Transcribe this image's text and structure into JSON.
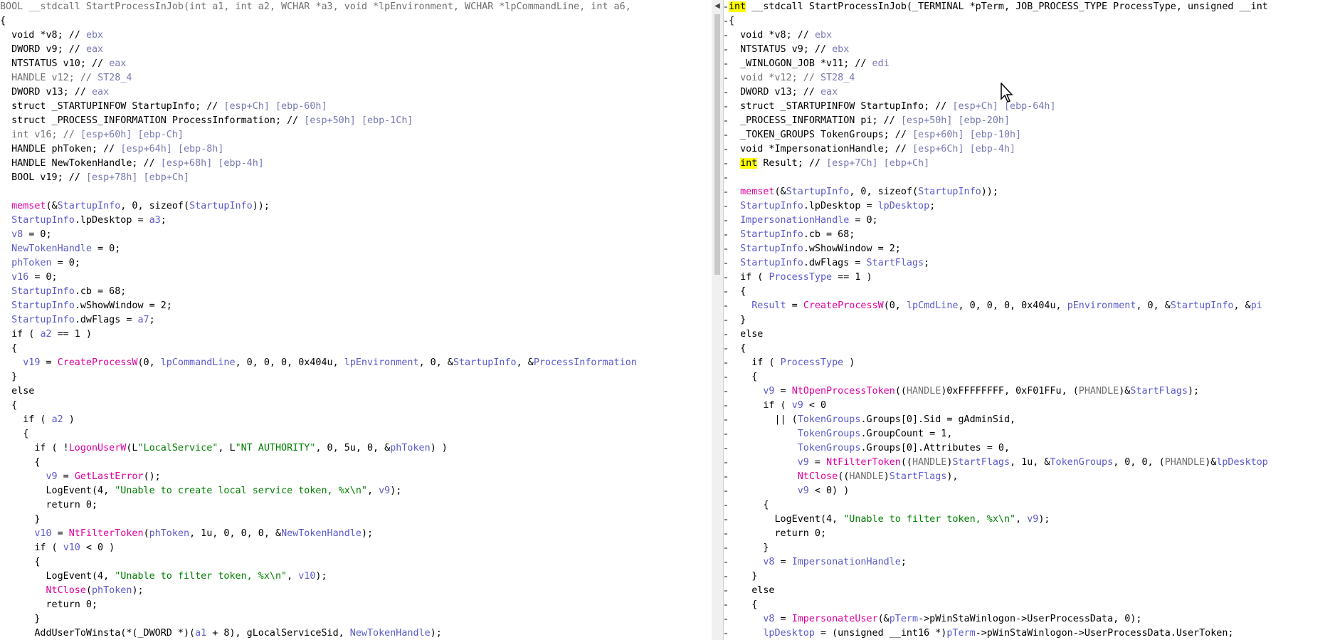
{
  "left_pane": {
    "lines": [
      [
        [
          "g",
          "BOOL __stdcall StartProcessInJob(int a1, int a2, WCHAR *a3, void *lpEnvironment, WCHAR *lpCommandLine, int a6, "
        ]
      ],
      [
        [
          "k",
          "{"
        ]
      ],
      [
        [
          "k",
          "  void *v8; // "
        ],
        [
          "c",
          "ebx"
        ]
      ],
      [
        [
          "k",
          "  DWORD v9; // "
        ],
        [
          "c",
          "eax"
        ]
      ],
      [
        [
          "k",
          "  NTSTATUS v10; // "
        ],
        [
          "c",
          "eax"
        ]
      ],
      [
        [
          "g",
          "  HANDLE v12; // "
        ],
        [
          "c",
          "ST28_4"
        ]
      ],
      [
        [
          "k",
          "  DWORD v13; // "
        ],
        [
          "c",
          "eax"
        ]
      ],
      [
        [
          "k",
          "  struct _STARTUPINFOW StartupInfo; // "
        ],
        [
          "c",
          "[esp+Ch] [ebp-60h]"
        ]
      ],
      [
        [
          "k",
          "  struct _PROCESS_INFORMATION ProcessInformation; // "
        ],
        [
          "c",
          "[esp+50h] [ebp-1Ch]"
        ]
      ],
      [
        [
          "g",
          "  int v16; // "
        ],
        [
          "c",
          "[esp+60h] [ebp-Ch]"
        ]
      ],
      [
        [
          "k",
          "  HANDLE phToken; // "
        ],
        [
          "c",
          "[esp+64h] [ebp-8h]"
        ]
      ],
      [
        [
          "k",
          "  HANDLE NewTokenHandle; // "
        ],
        [
          "c",
          "[esp+68h] [ebp-4h]"
        ]
      ],
      [
        [
          "k",
          "  BOOL v19; // "
        ],
        [
          "c",
          "[esp+78h] [ebp+Ch]"
        ]
      ],
      [
        [
          "k",
          ""
        ]
      ],
      [
        [
          "f",
          "  memset"
        ],
        [
          "k",
          "(&"
        ],
        [
          "v",
          "StartupInfo"
        ],
        [
          "k",
          ", 0, sizeof("
        ],
        [
          "v",
          "StartupInfo"
        ],
        [
          "k",
          "));"
        ]
      ],
      [
        [
          "v",
          "  StartupInfo"
        ],
        [
          "k",
          ".lpDesktop = "
        ],
        [
          "v",
          "a3"
        ],
        [
          "k",
          ";"
        ]
      ],
      [
        [
          "v",
          "  v8"
        ],
        [
          "k",
          " = 0;"
        ]
      ],
      [
        [
          "v",
          "  NewTokenHandle"
        ],
        [
          "k",
          " = 0;"
        ]
      ],
      [
        [
          "v",
          "  phToken"
        ],
        [
          "k",
          " = 0;"
        ]
      ],
      [
        [
          "v",
          "  v16"
        ],
        [
          "k",
          " = 0;"
        ]
      ],
      [
        [
          "v",
          "  StartupInfo"
        ],
        [
          "k",
          ".cb = 68;"
        ]
      ],
      [
        [
          "v",
          "  StartupInfo"
        ],
        [
          "k",
          ".wShowWindow = 2;"
        ]
      ],
      [
        [
          "v",
          "  StartupInfo"
        ],
        [
          "k",
          ".dwFlags = "
        ],
        [
          "v",
          "a7"
        ],
        [
          "k",
          ";"
        ]
      ],
      [
        [
          "k",
          "  if ( "
        ],
        [
          "v",
          "a2"
        ],
        [
          "k",
          " == 1 )"
        ]
      ],
      [
        [
          "k",
          "  {"
        ]
      ],
      [
        [
          "v",
          "    v19"
        ],
        [
          "k",
          " = "
        ],
        [
          "f",
          "CreateProcessW"
        ],
        [
          "k",
          "(0, "
        ],
        [
          "v",
          "lpCommandLine"
        ],
        [
          "k",
          ", 0, 0, 0, 0x404u, "
        ],
        [
          "v",
          "lpEnvironment"
        ],
        [
          "k",
          ", 0, &"
        ],
        [
          "v",
          "StartupInfo"
        ],
        [
          "k",
          ", &"
        ],
        [
          "v",
          "ProcessInformation"
        ]
      ],
      [
        [
          "k",
          "  }"
        ]
      ],
      [
        [
          "k",
          "  else"
        ]
      ],
      [
        [
          "k",
          "  {"
        ]
      ],
      [
        [
          "k",
          "    if ( "
        ],
        [
          "v",
          "a2"
        ],
        [
          "k",
          " )"
        ]
      ],
      [
        [
          "k",
          "    {"
        ]
      ],
      [
        [
          "k",
          "      if ( !"
        ],
        [
          "f",
          "LogonUserW"
        ],
        [
          "k",
          "(L"
        ],
        [
          "s",
          "\"LocalService\""
        ],
        [
          "k",
          ", L"
        ],
        [
          "s",
          "\"NT AUTHORITY\""
        ],
        [
          "k",
          ", 0, 5u, 0, &"
        ],
        [
          "v",
          "phToken"
        ],
        [
          "k",
          ") )"
        ]
      ],
      [
        [
          "k",
          "      {"
        ]
      ],
      [
        [
          "v",
          "        v9"
        ],
        [
          "k",
          " = "
        ],
        [
          "f",
          "GetLastError"
        ],
        [
          "k",
          "();"
        ]
      ],
      [
        [
          "k",
          "        LogEvent(4, "
        ],
        [
          "s",
          "\"Unable to create local service token, %x\\n\""
        ],
        [
          "k",
          ", "
        ],
        [
          "v",
          "v9"
        ],
        [
          "k",
          ");"
        ]
      ],
      [
        [
          "k",
          "        return 0;"
        ]
      ],
      [
        [
          "k",
          "      }"
        ]
      ],
      [
        [
          "v",
          "      v10"
        ],
        [
          "k",
          " = "
        ],
        [
          "f",
          "NtFilterToken"
        ],
        [
          "k",
          "("
        ],
        [
          "v",
          "phToken"
        ],
        [
          "k",
          ", 1u, 0, 0, 0, &"
        ],
        [
          "v",
          "NewTokenHandle"
        ],
        [
          "k",
          ");"
        ]
      ],
      [
        [
          "k",
          "      if ( "
        ],
        [
          "v",
          "v10"
        ],
        [
          "k",
          " < 0 )"
        ]
      ],
      [
        [
          "k",
          "      {"
        ]
      ],
      [
        [
          "k",
          "        LogEvent(4, "
        ],
        [
          "s",
          "\"Unable to filter token, %x\\n\""
        ],
        [
          "k",
          ", "
        ],
        [
          "v",
          "v10"
        ],
        [
          "k",
          ");"
        ]
      ],
      [
        [
          "f",
          "        NtClose"
        ],
        [
          "k",
          "("
        ],
        [
          "v",
          "phToken"
        ],
        [
          "k",
          ");"
        ]
      ],
      [
        [
          "k",
          "        return 0;"
        ]
      ],
      [
        [
          "k",
          "      }"
        ]
      ],
      [
        [
          "k",
          "      AddUserToWinsta(*(_DWORD *)("
        ],
        [
          "v",
          "a1"
        ],
        [
          "k",
          " + 8), gLocalServiceSid, "
        ],
        [
          "v",
          "NewTokenHandle"
        ],
        [
          "k",
          ");"
        ]
      ]
    ]
  },
  "right_pane": {
    "lines": [
      [
        [
          "h",
          "int"
        ],
        [
          "k",
          " __stdcall StartProcessInJob(_TERMINAL *pTerm, JOB_PROCESS_TYPE ProcessType, unsigned __int"
        ]
      ],
      [
        [
          "k",
          "{"
        ]
      ],
      [
        [
          "k",
          "  void *v8; // "
        ],
        [
          "c",
          "ebx"
        ]
      ],
      [
        [
          "k",
          "  NTSTATUS v9; // "
        ],
        [
          "c",
          "ebx"
        ]
      ],
      [
        [
          "k",
          "  _WINLOGON_JOB *v11; // "
        ],
        [
          "c",
          "edi"
        ]
      ],
      [
        [
          "g",
          "  void *v12; // "
        ],
        [
          "c",
          "ST28_4"
        ]
      ],
      [
        [
          "k",
          "  DWORD v13; // "
        ],
        [
          "c",
          "eax"
        ]
      ],
      [
        [
          "k",
          "  struct _STARTUPINFOW StartupInfo; // "
        ],
        [
          "c",
          "[esp+Ch] [ebp-64h]"
        ]
      ],
      [
        [
          "k",
          "  _PROCESS_INFORMATION pi; // "
        ],
        [
          "c",
          "[esp+50h] [ebp-20h]"
        ]
      ],
      [
        [
          "k",
          "  _TOKEN_GROUPS TokenGroups; // "
        ],
        [
          "c",
          "[esp+60h] [ebp-10h]"
        ]
      ],
      [
        [
          "k",
          "  void *ImpersonationHandle; // "
        ],
        [
          "c",
          "[esp+6Ch] [ebp-4h]"
        ]
      ],
      [
        [
          "k",
          "  "
        ],
        [
          "h",
          "int"
        ],
        [
          "k",
          " Result; // "
        ],
        [
          "c",
          "[esp+7Ch] [ebp+Ch]"
        ]
      ],
      [
        [
          "k",
          ""
        ]
      ],
      [
        [
          "f",
          "  memset"
        ],
        [
          "k",
          "(&"
        ],
        [
          "v",
          "StartupInfo"
        ],
        [
          "k",
          ", 0, sizeof("
        ],
        [
          "v",
          "StartupInfo"
        ],
        [
          "k",
          "));"
        ]
      ],
      [
        [
          "v",
          "  StartupInfo"
        ],
        [
          "k",
          ".lpDesktop = "
        ],
        [
          "v",
          "lpDesktop"
        ],
        [
          "k",
          ";"
        ]
      ],
      [
        [
          "v",
          "  ImpersonationHandle"
        ],
        [
          "k",
          " = 0;"
        ]
      ],
      [
        [
          "v",
          "  StartupInfo"
        ],
        [
          "k",
          ".cb = 68;"
        ]
      ],
      [
        [
          "v",
          "  StartupInfo"
        ],
        [
          "k",
          ".wShowWindow = 2;"
        ]
      ],
      [
        [
          "v",
          "  StartupInfo"
        ],
        [
          "k",
          ".dwFlags = "
        ],
        [
          "v",
          "StartFlags"
        ],
        [
          "k",
          ";"
        ]
      ],
      [
        [
          "k",
          "  if ( "
        ],
        [
          "v",
          "ProcessType"
        ],
        [
          "k",
          " == 1 )"
        ]
      ],
      [
        [
          "k",
          "  {"
        ]
      ],
      [
        [
          "v",
          "    Result"
        ],
        [
          "k",
          " = "
        ],
        [
          "f",
          "CreateProcessW"
        ],
        [
          "k",
          "(0, "
        ],
        [
          "v",
          "lpCmdLine"
        ],
        [
          "k",
          ", 0, 0, 0, 0x404u, "
        ],
        [
          "v",
          "pEnvironment"
        ],
        [
          "k",
          ", 0, &"
        ],
        [
          "v",
          "StartupInfo"
        ],
        [
          "k",
          ", &"
        ],
        [
          "v",
          "pi"
        ]
      ],
      [
        [
          "k",
          "  }"
        ]
      ],
      [
        [
          "k",
          "  else"
        ]
      ],
      [
        [
          "k",
          "  {"
        ]
      ],
      [
        [
          "k",
          "    if ( "
        ],
        [
          "v",
          "ProcessType"
        ],
        [
          "k",
          " )"
        ]
      ],
      [
        [
          "k",
          "    {"
        ]
      ],
      [
        [
          "v",
          "      v9"
        ],
        [
          "k",
          " = "
        ],
        [
          "f",
          "NtOpenProcessToken"
        ],
        [
          "k",
          "(("
        ],
        [
          "g",
          "HANDLE"
        ],
        [
          "k",
          ")0xFFFFFFFF, 0xF01FFu, ("
        ],
        [
          "g",
          "PHANDLE"
        ],
        [
          "k",
          ")&"
        ],
        [
          "v",
          "StartFlags"
        ],
        [
          "k",
          ");"
        ]
      ],
      [
        [
          "k",
          "      if ( "
        ],
        [
          "v",
          "v9"
        ],
        [
          "k",
          " < 0"
        ]
      ],
      [
        [
          "k",
          "        || ("
        ],
        [
          "v",
          "TokenGroups"
        ],
        [
          "k",
          ".Groups[0].Sid = gAdminSid,"
        ]
      ],
      [
        [
          "v",
          "            TokenGroups"
        ],
        [
          "k",
          ".GroupCount = 1,"
        ]
      ],
      [
        [
          "v",
          "            TokenGroups"
        ],
        [
          "k",
          ".Groups[0].Attributes = 0,"
        ]
      ],
      [
        [
          "v",
          "            v9"
        ],
        [
          "k",
          " = "
        ],
        [
          "f",
          "NtFilterToken"
        ],
        [
          "k",
          "(("
        ],
        [
          "g",
          "HANDLE"
        ],
        [
          "k",
          ")"
        ],
        [
          "v",
          "StartFlags"
        ],
        [
          "k",
          ", 1u, &"
        ],
        [
          "v",
          "TokenGroups"
        ],
        [
          "k",
          ", 0, 0, ("
        ],
        [
          "g",
          "PHANDLE"
        ],
        [
          "k",
          ")&"
        ],
        [
          "v",
          "lpDesktop"
        ]
      ],
      [
        [
          "f",
          "            NtClose"
        ],
        [
          "k",
          "(("
        ],
        [
          "g",
          "HANDLE"
        ],
        [
          "k",
          ")"
        ],
        [
          "v",
          "StartFlags"
        ],
        [
          "k",
          "),"
        ]
      ],
      [
        [
          "v",
          "            v9"
        ],
        [
          "k",
          " < 0) )"
        ]
      ],
      [
        [
          "k",
          "      {"
        ]
      ],
      [
        [
          "k",
          "        LogEvent(4, "
        ],
        [
          "s",
          "\"Unable to filter token, %x\\n\""
        ],
        [
          "k",
          ", "
        ],
        [
          "v",
          "v9"
        ],
        [
          "k",
          ");"
        ]
      ],
      [
        [
          "k",
          "        return 0;"
        ]
      ],
      [
        [
          "k",
          "      }"
        ]
      ],
      [
        [
          "v",
          "      v8"
        ],
        [
          "k",
          " = "
        ],
        [
          "v",
          "ImpersonationHandle"
        ],
        [
          "k",
          ";"
        ]
      ],
      [
        [
          "k",
          "    }"
        ]
      ],
      [
        [
          "k",
          "    else"
        ]
      ],
      [
        [
          "k",
          "    {"
        ]
      ],
      [
        [
          "v",
          "      v8"
        ],
        [
          "k",
          " = "
        ],
        [
          "f",
          "ImpersonateUser"
        ],
        [
          "k",
          "(&"
        ],
        [
          "v",
          "pTerm"
        ],
        [
          "k",
          "->pWinStaWinlogon->UserProcessData, 0);"
        ]
      ],
      [
        [
          "v",
          "      lpDesktop"
        ],
        [
          "k",
          " = (unsigned __int16 *)"
        ],
        [
          "v",
          "pTerm"
        ],
        [
          "k",
          "->pWinStaWinlogon->UserProcessData.UserToken;"
        ]
      ]
    ]
  },
  "scroll_arrow": "◀"
}
